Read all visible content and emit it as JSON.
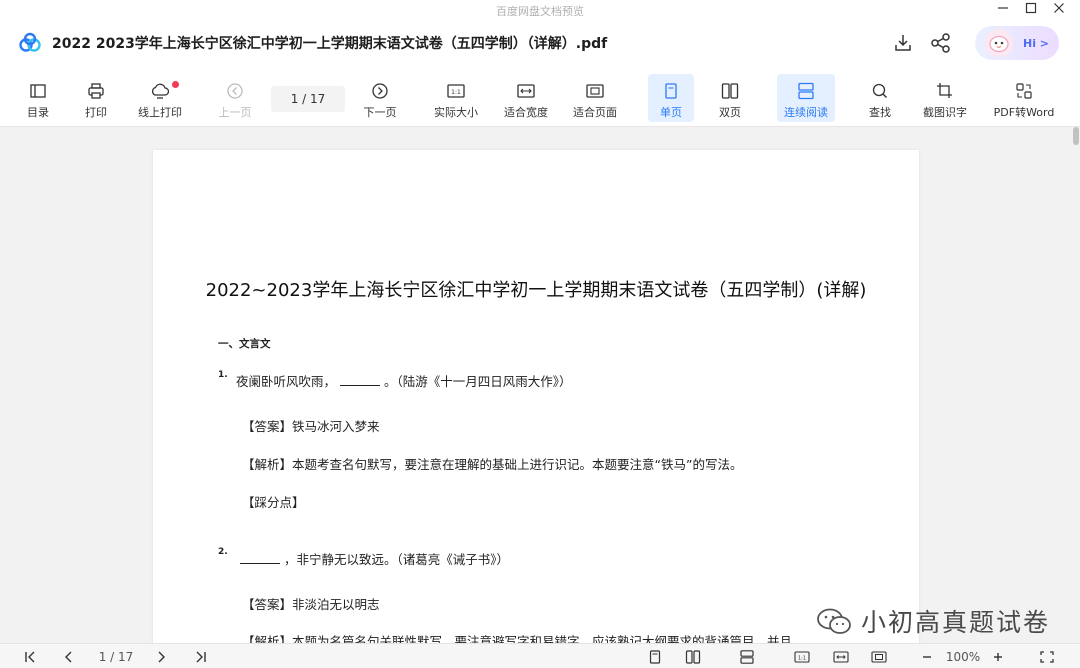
{
  "window": {
    "caption": "百度网盘文档预览",
    "min_icon": "minimize-icon",
    "max_icon": "maximize-icon",
    "close_icon": "close-icon"
  },
  "header": {
    "doc_title": "2022  2023学年上海长宁区徐汇中学初一上学期期末语文试卷（五四学制）（详解）.pdf",
    "assistant_label": "Hi >",
    "accent": "#2d7bf4"
  },
  "toolbar": {
    "items": [
      {
        "label": "目录",
        "icon": "toc-icon"
      },
      {
        "label": "打印",
        "icon": "printer-icon"
      },
      {
        "label": "线上打印",
        "icon": "cloud-print-icon"
      },
      {
        "label": "上一页",
        "icon": "prev-page-icon"
      },
      {
        "label": "下一页",
        "icon": "next-page-icon"
      },
      {
        "label": "实际大小",
        "icon": "actual-size-icon"
      },
      {
        "label": "适合宽度",
        "icon": "fit-width-icon"
      },
      {
        "label": "适合页面",
        "icon": "fit-page-icon"
      },
      {
        "label": "单页",
        "icon": "single-page-icon"
      },
      {
        "label": "双页",
        "icon": "double-page-icon"
      },
      {
        "label": "连续阅读",
        "icon": "continuous-icon"
      },
      {
        "label": "查找",
        "icon": "search-icon"
      },
      {
        "label": "截图识字",
        "icon": "crop-ocr-icon"
      },
      {
        "label": "PDF转Word",
        "icon": "pdf-to-word-icon"
      }
    ],
    "page_indicator": "1  /  17"
  },
  "document": {
    "title": "2022~2023学年上海长宁区徐汇中学初一上学期期末语文试卷（五四学制）(详解)",
    "section": "一、文言文",
    "q1_num": "1.",
    "q1_pre": "夜阑卧听风吹雨，",
    "q1_post": "。（陆游《十一月四日风雨大作》）",
    "q1_answer": "【答案】铁马冰河入梦来",
    "q1_analysis": "【解析】本题考查名句默写，要注意在理解的基础上进行识记。本题要注意“铁马”的写法。",
    "q1_points": "【踩分点】",
    "q2_num": "2.",
    "q2_post": "，非宁静无以致远。（诸葛亮《诫子书》）",
    "q2_answer": "【答案】非淡泊无以明志",
    "q2_analysis": "【解析】本题为名篇名句关联性默写，要注意避写字和易错字，应该熟记大纲要求的背诵篇目，并且"
  },
  "watermark": {
    "text": "小初高真题试卷"
  },
  "statusbar": {
    "page_indicator": "1  /  17",
    "zoom": "100%"
  }
}
